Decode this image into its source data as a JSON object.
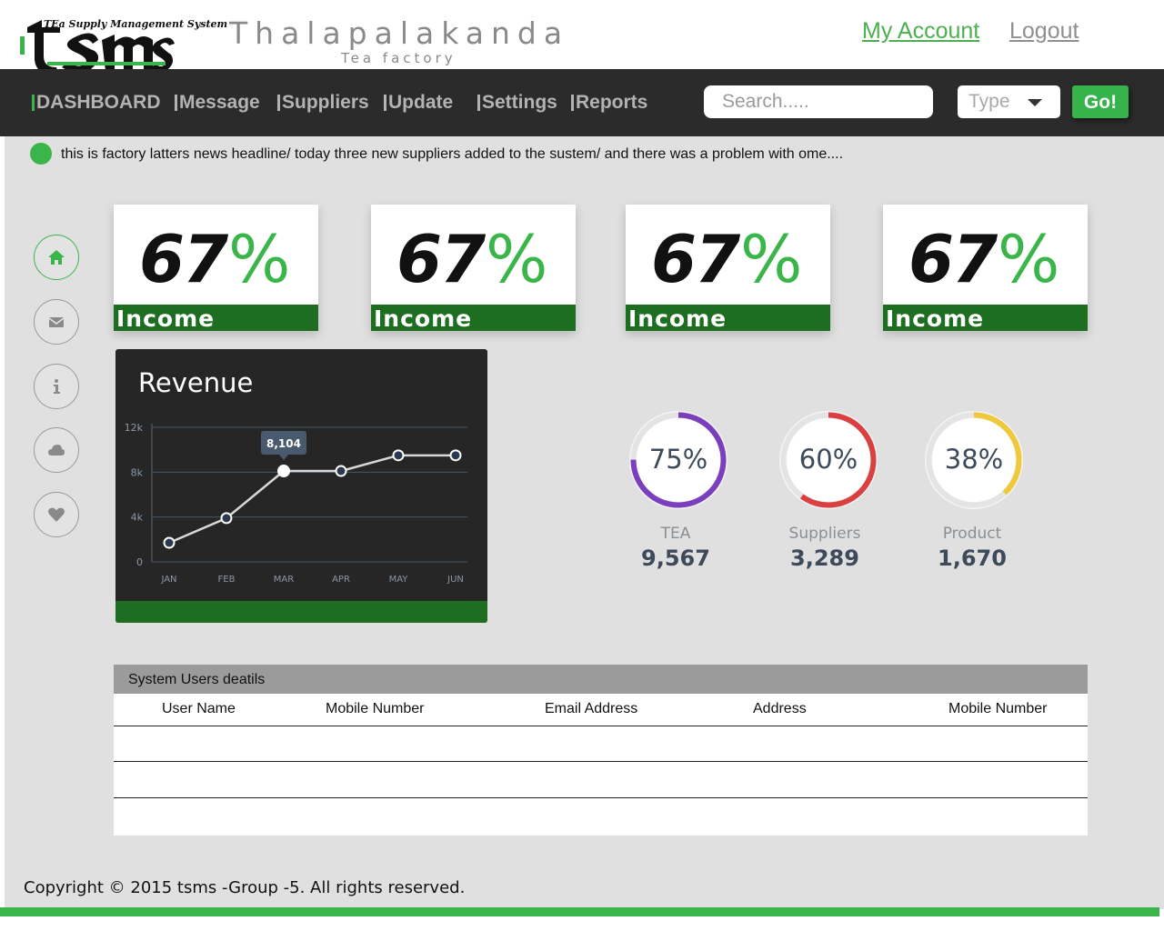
{
  "header": {
    "logo_tagline": "TEa Supply Management System",
    "logo_text": "tsms",
    "brand_name": "Thalapalakanda",
    "brand_sub": "Tea factory",
    "my_account": "My Account",
    "logout": "Logout"
  },
  "nav": {
    "items": [
      {
        "label": "DASHBOARD"
      },
      {
        "label": "Message"
      },
      {
        "label": "Suppliers"
      },
      {
        "label": "Update"
      },
      {
        "label": "Settings"
      },
      {
        "label": "Reports"
      }
    ],
    "search_placeholder": "Search.....",
    "type_label": "Type",
    "go_label": "Go!"
  },
  "news": {
    "headline": "this is factory latters news headline/ today three new suppliers added to the sustem/ and there was a problem with ome...."
  },
  "sidebar": {
    "icons": [
      "home-icon",
      "mail-icon",
      "info-icon",
      "cloud-icon",
      "heart-icon"
    ]
  },
  "stats": [
    {
      "value": "67",
      "unit": "%",
      "label": "Income"
    },
    {
      "value": "67",
      "unit": "%",
      "label": "Income"
    },
    {
      "value": "67",
      "unit": "%",
      "label": "Income"
    },
    {
      "value": "67",
      "unit": "%",
      "label": "Income"
    }
  ],
  "revenue": {
    "title": "Revenue",
    "tooltip": "8,104"
  },
  "chart_data": {
    "type": "line",
    "title": "Revenue",
    "categories": [
      "JAN",
      "FEB",
      "MAR",
      "APR",
      "MAY",
      "JUN"
    ],
    "values": [
      1700,
      3900,
      8104,
      8104,
      9500,
      9500
    ],
    "yticks": [
      "0",
      "4k",
      "8k",
      "12k"
    ],
    "ylim": [
      0,
      12000
    ],
    "grid": true,
    "highlight": {
      "category": "MAR",
      "label": "8,104"
    }
  },
  "rings": [
    {
      "percent_text": "75%",
      "percent": 75,
      "label": "TEA",
      "count": "9,567",
      "color": "#7b3fbe"
    },
    {
      "percent_text": "60%",
      "percent": 60,
      "label": "Suppliers",
      "count": "3,289",
      "color": "#d9403f"
    },
    {
      "percent_text": "38%",
      "percent": 38,
      "label": "Product",
      "count": "1,670",
      "color": "#f0c93a"
    }
  ],
  "users_table": {
    "title": "System Users deatils",
    "columns": [
      "User Name",
      "Mobile Number",
      "Email Address",
      "Address",
      "Mobile Number"
    ]
  },
  "footer": {
    "copyright": "Copyright © 2015 tsms -Group -5. All rights reserved."
  },
  "colors": {
    "accent_green": "#3ab54a",
    "dark_green": "#1e6e22",
    "navbar": "#2b2b2b"
  }
}
